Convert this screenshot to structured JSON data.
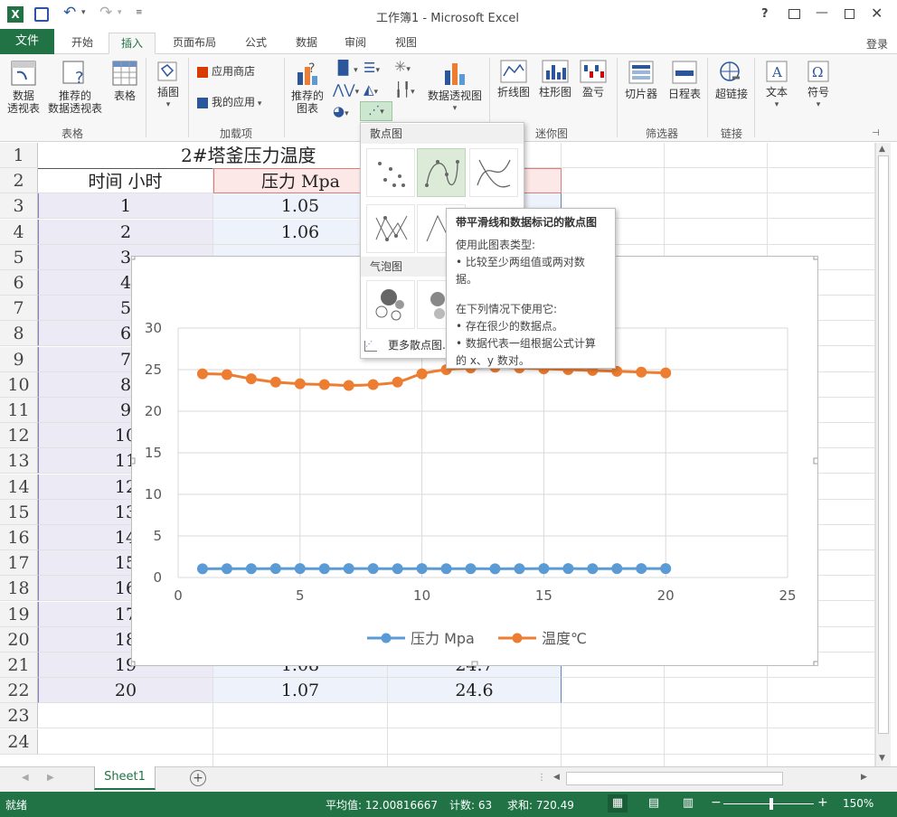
{
  "window": {
    "title": "工作簿1 - Microsoft Excel",
    "help": "?",
    "login": "登录"
  },
  "tabs": [
    "文件",
    "开始",
    "插入",
    "页面布局",
    "公式",
    "数据",
    "审阅",
    "视图"
  ],
  "ribbon": {
    "pivot": "数据\n透视表",
    "recommended_pivot": "推荐的\n数据透视表",
    "table": "表格",
    "group_tables": "表格",
    "illustrations": "插图",
    "app_store": "应用商店",
    "my_apps": "我的应用",
    "group_addins": "加载项",
    "recommended_charts": "推荐的\n图表",
    "pivot_chart": "数据透视图",
    "line_spark": "折线图",
    "column_spark": "柱形图",
    "winloss_spark": "盈亏",
    "group_sparklines": "迷你图",
    "slicer": "切片器",
    "timeline": "日程表",
    "group_filters": "筛选器",
    "hyperlink": "超链接",
    "group_links": "链接",
    "text": "文本",
    "symbol": "符号"
  },
  "sheet": {
    "title_partial": "2#塔釜压力温度",
    "headers": [
      "时间 小时",
      "压力 Mpa"
    ],
    "row_numbers": [
      "1",
      "2",
      "3",
      "4",
      "5",
      "6",
      "7",
      "8",
      "9",
      "10",
      "11",
      "12",
      "13",
      "14",
      "15",
      "16",
      "17",
      "18",
      "19",
      "20",
      "21",
      "22",
      "23",
      "24"
    ],
    "col_a": [
      "1",
      "2",
      "3",
      "4",
      "5",
      "6",
      "7",
      "8",
      "9",
      "10",
      "11",
      "12",
      "13",
      "14",
      "15",
      "16",
      "17",
      "18",
      "19",
      "20"
    ],
    "visible_b": [
      "1.05",
      "1.06"
    ],
    "row21": {
      "a": "19",
      "b": "1.08",
      "c": "24.7"
    },
    "row22": {
      "a": "20",
      "b": "1.07",
      "c": "24.6"
    },
    "sheet_tab": "Sheet1"
  },
  "gallery": {
    "scatter_header": "散点图",
    "bubble_header": "气泡图",
    "more": "更多散点图..."
  },
  "tooltip": {
    "title": "带平滑线和数据标记的散点图",
    "use_title": "使用此图表类型:",
    "use_line": "• 比较至少两组值或两对数据。",
    "when_title": "在下列情况下使用它:",
    "when_1": "• 存在很少的数据点。",
    "when_2": "• 数据代表一组根据公式计算的 x、y 数对。"
  },
  "status": {
    "ready": "就绪",
    "average": "平均值: 12.00816667",
    "count": "计数: 63",
    "sum": "求和: 720.49",
    "zoom": "150%"
  },
  "colors": {
    "excel_green": "#217346",
    "series_pressure": "#5b9bd5",
    "series_temp": "#ed7d31"
  },
  "chart_data": {
    "type": "scatter",
    "x": [
      1,
      2,
      3,
      4,
      5,
      6,
      7,
      8,
      9,
      10,
      11,
      12,
      13,
      14,
      15,
      16,
      17,
      18,
      19,
      20
    ],
    "series": [
      {
        "name": "压力 Mpa",
        "values": [
          1.05,
          1.06,
          1.06,
          1.07,
          1.07,
          1.06,
          1.07,
          1.07,
          1.06,
          1.07,
          1.06,
          1.06,
          1.05,
          1.06,
          1.07,
          1.07,
          1.06,
          1.07,
          1.08,
          1.07
        ]
      },
      {
        "name": "温度℃",
        "values": [
          24.5,
          24.4,
          23.9,
          23.5,
          23.3,
          23.2,
          23.1,
          23.2,
          23.5,
          24.5,
          25.0,
          25.2,
          25.3,
          25.2,
          25.1,
          25.0,
          24.9,
          24.8,
          24.7,
          24.6
        ]
      }
    ],
    "xlim": [
      0,
      25
    ],
    "ylim": [
      0,
      30
    ],
    "xticks": [
      "0",
      "5",
      "10",
      "15",
      "20",
      "25"
    ],
    "yticks": [
      "0",
      "5",
      "10",
      "15",
      "20",
      "25",
      "30"
    ],
    "smooth": true,
    "grid": true,
    "legend": "bottom"
  }
}
